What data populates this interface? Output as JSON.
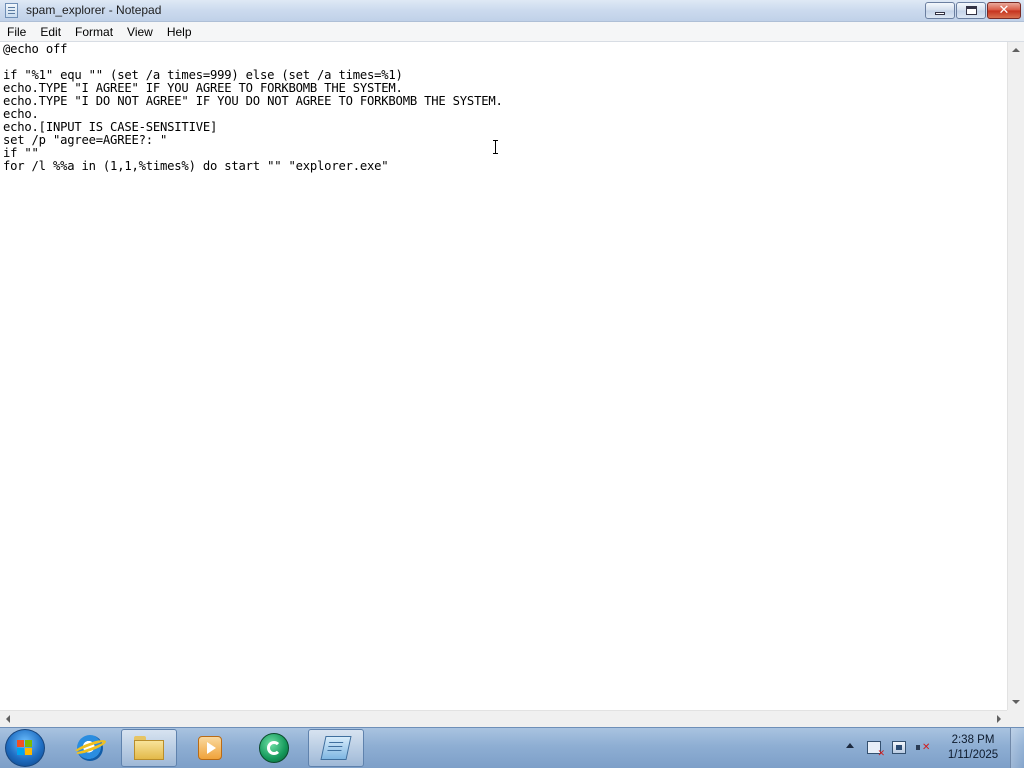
{
  "window": {
    "title": "spam_explorer - Notepad"
  },
  "menu": {
    "file": "File",
    "edit": "Edit",
    "format": "Format",
    "view": "View",
    "help": "Help"
  },
  "editor": {
    "text": "@echo off\n\nif \"%1\" equ \"\" (set /a times=999) else (set /a times=%1)\necho.TYPE \"I AGREE\" IF YOU AGREE TO FORKBOMB THE SYSTEM.\necho.TYPE \"I DO NOT AGREE\" IF YOU DO NOT AGREE TO FORKBOMB THE SYSTEM.\necho.\necho.[INPUT IS CASE-SENSITIVE]\nset /p \"agree=AGREE?: \"\nif \"\"\nfor /l %%a in (1,1,%times%) do start \"\" \"explorer.exe\""
  },
  "taskbar": {
    "start_icon": "windows-flag-icon",
    "pinned": [
      {
        "icon": "internet-explorer-icon"
      },
      {
        "icon": "folder-icon"
      },
      {
        "icon": "media-player-icon"
      },
      {
        "icon": "green-app-icon"
      },
      {
        "icon": "notepad-icon"
      }
    ]
  },
  "tray": {
    "time": "2:38 PM",
    "date": "1/11/2025"
  },
  "colors": {
    "taskbar": "#8eaed3",
    "titlebar": "#cbdaee",
    "close_button": "#c5301c"
  }
}
